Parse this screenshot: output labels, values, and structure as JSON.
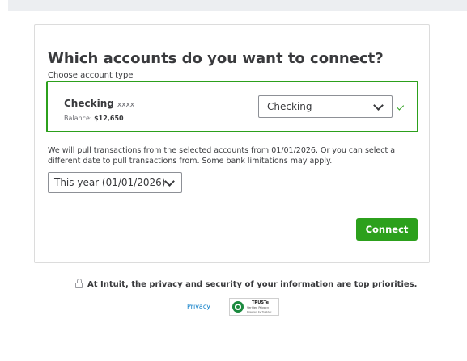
{
  "card": {
    "title": "Which accounts do you want to connect?",
    "subtitle": "Choose account type"
  },
  "account": {
    "name": "Checking",
    "mask": "xxxx",
    "balance_label": "Balance:",
    "balance_value": "$12,650",
    "type_selected": "Checking",
    "selected": true
  },
  "info_text": "We will pull transactions from the selected accounts from 01/01/2026. Or you can select a different date to pull transactions from. Some bank limitations may apply.",
  "date_range": {
    "selected": "This year (01/01/2026)"
  },
  "buttons": {
    "connect": "Connect"
  },
  "footer": {
    "privacy_statement": "At Intuit, the privacy and security of your information are top priorities.",
    "privacy_link": "Privacy",
    "truste": {
      "title": "TRUSTe",
      "line1": "Verified Privacy",
      "line2": "Powered by TrustArc"
    }
  },
  "colors": {
    "accent_green": "#2ca01c",
    "link_blue": "#0077c5",
    "text_dark": "#393a3d"
  },
  "icons": [
    "lock-icon",
    "chevron-down-icon",
    "checkmark-icon",
    "truste-seal-icon"
  ]
}
